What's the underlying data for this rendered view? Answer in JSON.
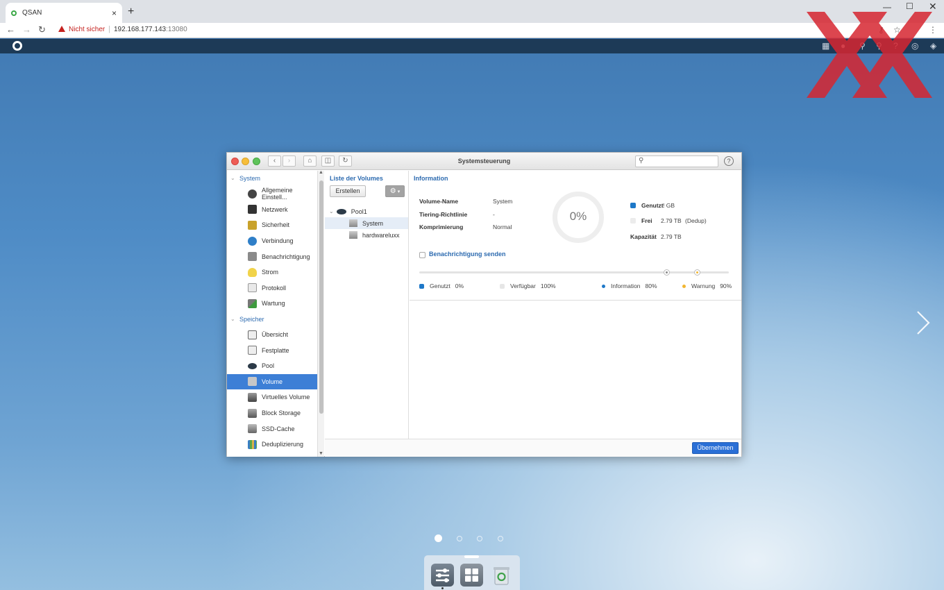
{
  "browser": {
    "tab_title": "QSAN",
    "close_tab": "×",
    "new_tab": "+",
    "security_label": "Nicht sicher",
    "url_host": "192.168.177.143",
    "url_port": ":13080"
  },
  "window": {
    "title": "Systemsteuerung",
    "help": "?"
  },
  "sidebar": {
    "sections": [
      {
        "label": "System",
        "items": [
          {
            "label": "Allgemeine Einstell...",
            "icon": "settings-wheel-icon"
          },
          {
            "label": "Netzwerk",
            "icon": "network-icon"
          },
          {
            "label": "Sicherheit",
            "icon": "lock-icon"
          },
          {
            "label": "Verbindung",
            "icon": "globe-icon"
          },
          {
            "label": "Benachrichtigung",
            "icon": "bell-icon"
          },
          {
            "label": "Strom",
            "icon": "bulb-icon"
          },
          {
            "label": "Protokoll",
            "icon": "log-icon"
          },
          {
            "label": "Wartung",
            "icon": "tools-icon"
          }
        ]
      },
      {
        "label": "Speicher",
        "items": [
          {
            "label": "Übersicht",
            "icon": "overview-icon"
          },
          {
            "label": "Festplatte",
            "icon": "disk-icon"
          },
          {
            "label": "Pool",
            "icon": "pool-icon"
          },
          {
            "label": "Volume",
            "icon": "volume-icon",
            "active": true
          },
          {
            "label": "Virtuelles Volume",
            "icon": "virtual-volume-icon"
          },
          {
            "label": "Block Storage",
            "icon": "block-storage-icon"
          },
          {
            "label": "SSD-Cache",
            "icon": "ssd-cache-icon"
          },
          {
            "label": "Deduplizierung",
            "icon": "dedup-icon"
          }
        ]
      }
    ]
  },
  "volumes": {
    "heading": "Liste der Volumes",
    "create_label": "Erstellen",
    "tree": [
      {
        "label": "Pool1",
        "level": 0
      },
      {
        "label": "System",
        "level": 1,
        "selected": true
      },
      {
        "label": "hardwareluxx",
        "level": 1
      }
    ]
  },
  "info": {
    "heading": "Information",
    "fields": [
      {
        "label": "Volume-Name",
        "value": "System"
      },
      {
        "label": "Tiering-Richtlinie",
        "value": "-"
      },
      {
        "label": "Komprimierung",
        "value": "Normal"
      }
    ],
    "donut_label": "0%",
    "used_pct": 0,
    "stats": {
      "used_label": "Genutzt",
      "used_value": "! GB",
      "free_label": "Frei",
      "free_value": "2.79 TB",
      "free_note": "(Dedup)",
      "capacity_label": "Kapazität",
      "capacity_value": "2.79 TB"
    },
    "notify_label": "Benachrichtigung senden",
    "thresholds": {
      "information": 80,
      "warning": 90
    },
    "legend": [
      {
        "label": "Genutzt",
        "value": "0%",
        "color": "#1e78c8"
      },
      {
        "label": "Verfügbar",
        "value": "100%",
        "color": "#e6e6e6"
      },
      {
        "label": "Information",
        "value": "80%",
        "color": "#1e78c8"
      },
      {
        "label": "Warnung",
        "value": "90%",
        "color": "#f2b631"
      }
    ]
  },
  "footer": {
    "apply_label": "Übernehmen"
  },
  "desktop": {
    "page_count": 4,
    "current_page": 1
  },
  "colors": {
    "accent": "#2a6fd6",
    "sidebar_active": "#3d7fd6",
    "used": "#1e78c8",
    "warning": "#f2b631",
    "app_topbar": "#1d3a57"
  }
}
